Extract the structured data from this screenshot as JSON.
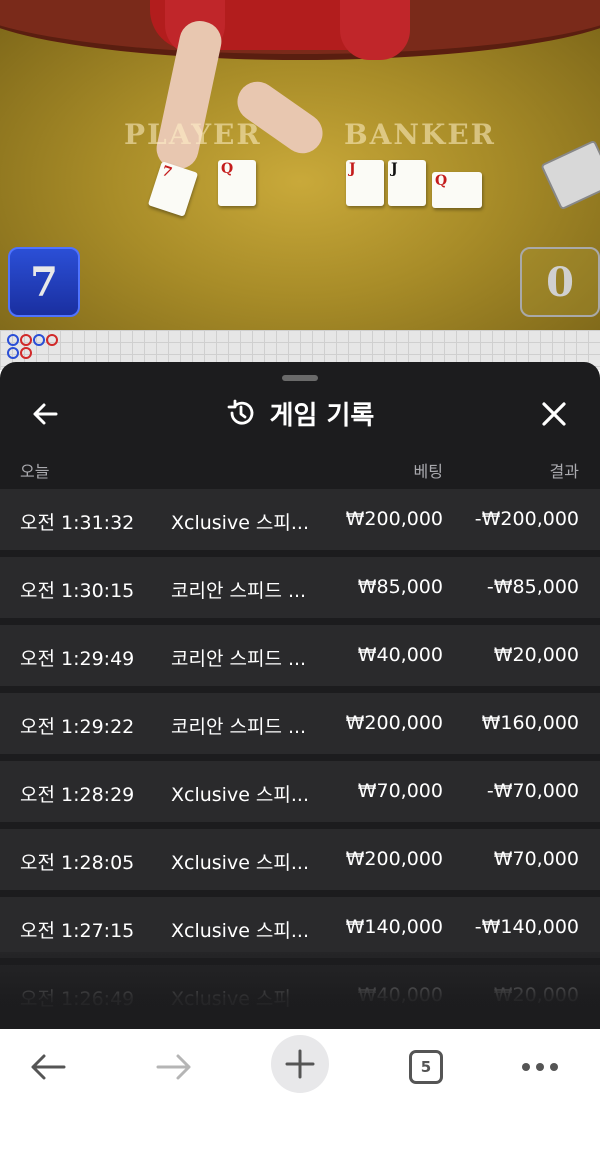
{
  "game_view": {
    "player_label": "PLAYER",
    "banker_label": "BANKER",
    "player_score": "7",
    "banker_score": "0",
    "player_cards": [
      "7",
      "Q"
    ],
    "banker_cards": [
      "J",
      "J",
      "Q"
    ]
  },
  "sheet": {
    "title": "게임 기록",
    "title_icon": "history-icon",
    "back_icon": "arrow-left-icon",
    "close_icon": "close-icon",
    "columns": {
      "day": "오늘",
      "bet": "베팅",
      "result": "결과"
    },
    "rows": [
      {
        "time": "오전 1:31:32",
        "game": "Xclusive 스피...",
        "bet": "₩200,000",
        "result": "-₩200,000"
      },
      {
        "time": "오전 1:30:15",
        "game": "코리안 스피드 ...",
        "bet": "₩85,000",
        "result": "-₩85,000"
      },
      {
        "time": "오전 1:29:49",
        "game": "코리안 스피드 ...",
        "bet": "₩40,000",
        "result": "₩20,000"
      },
      {
        "time": "오전 1:29:22",
        "game": "코리안 스피드 ...",
        "bet": "₩200,000",
        "result": "₩160,000"
      },
      {
        "time": "오전 1:28:29",
        "game": "Xclusive 스피...",
        "bet": "₩70,000",
        "result": "-₩70,000"
      },
      {
        "time": "오전 1:28:05",
        "game": "Xclusive 스피...",
        "bet": "₩200,000",
        "result": "₩70,000"
      },
      {
        "time": "오전 1:27:15",
        "game": "Xclusive 스피...",
        "bet": "₩140,000",
        "result": "-₩140,000"
      },
      {
        "time": "오전 1:26:49",
        "game": "Xclusive 스피",
        "bet": "₩40,000",
        "result": "₩20,000"
      }
    ]
  },
  "toolbar": {
    "back_icon": "arrow-left-icon",
    "forward_icon": "arrow-right-icon",
    "new_tab_icon": "plus-icon",
    "tab_count": "5",
    "menu_icon": "more-horizontal-icon"
  },
  "colors": {
    "sheet_bg": "#1c1c1e",
    "row_bg": "#2a2a2c",
    "player_blue": "#2b4fd6",
    "felt_gold": "#b3942e"
  }
}
